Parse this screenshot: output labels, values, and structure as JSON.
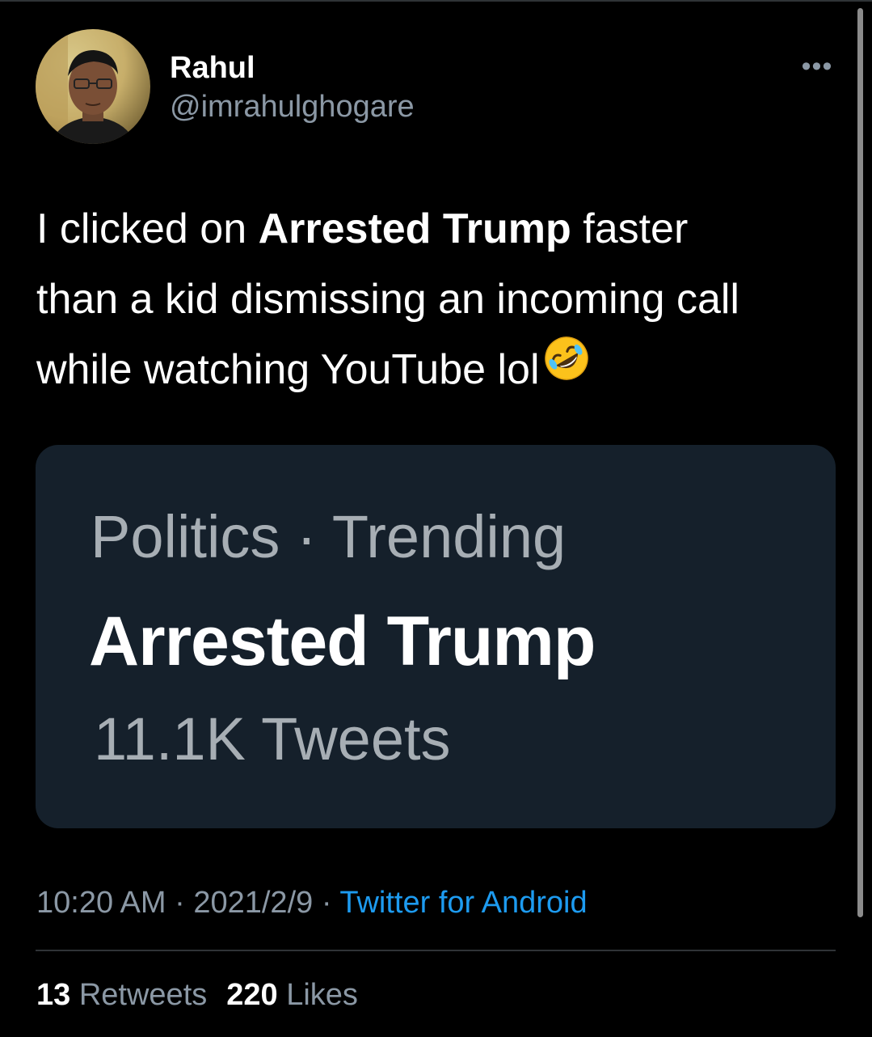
{
  "colors": {
    "background": "#000000",
    "card_background": "#15202b",
    "primary_text": "#ffffff",
    "secondary_text": "#8b98a5",
    "link": "#1d9bf0"
  },
  "author": {
    "display_name": "Rahul",
    "handle": "@imrahulghogare",
    "avatar_icon": "profile-photo"
  },
  "menu": {
    "more_icon": "more-dots-icon",
    "more_label": "•••"
  },
  "tweet": {
    "lines": [
      {
        "before": "I clicked on ",
        "bold": "Arrested Trump",
        "after": " faster"
      },
      {
        "text": "than a kid dismissing an incoming call"
      },
      {
        "text": "while watching YouTube lol",
        "emoji": "rolling-on-floor-laughing-emoji"
      }
    ]
  },
  "card": {
    "category": "Politics · Trending",
    "topic": "Arrested Trump",
    "count": "11.1K Tweets"
  },
  "meta": {
    "time": "10:20 AM",
    "separator": " · ",
    "date": "2021/2/9",
    "source": "Twitter for Android"
  },
  "stats": {
    "retweets_count": "13",
    "retweets_label": "Retweets",
    "likes_count": "220",
    "likes_label": "Likes"
  }
}
